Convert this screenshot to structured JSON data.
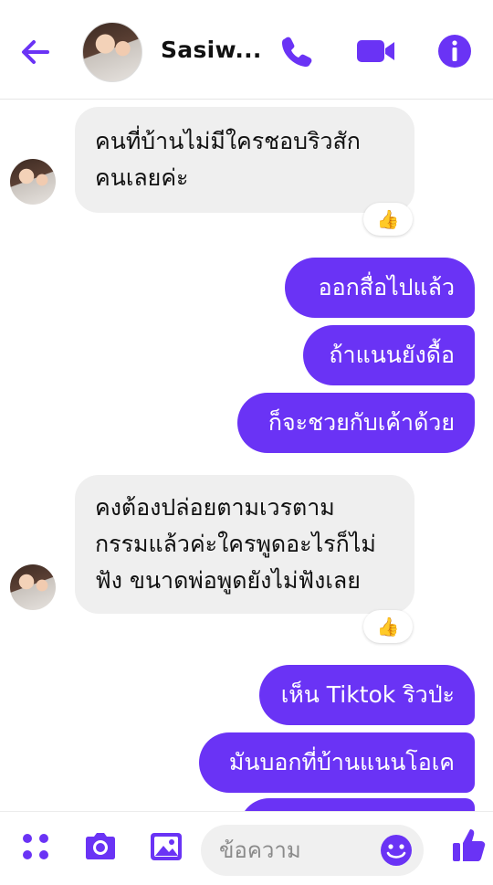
{
  "header": {
    "contact_name": "Sasiw...",
    "icons": [
      "back-arrow-icon",
      "phone-icon",
      "video-camera-icon",
      "info-icon"
    ]
  },
  "accent_color": "#6a33f5",
  "messages": [
    {
      "side": "in",
      "lines": [
        "คนที่บ้านไม่มีใครชอบริวสัก",
        "คนเลยค่ะ"
      ],
      "reaction": "👍"
    },
    {
      "side": "out",
      "text": "ออกสื่อไปแล้ว"
    },
    {
      "side": "out",
      "text": "ถ้าแนนยังดื้อ"
    },
    {
      "side": "out",
      "text": "ก็จะชวยกับเค้าด้วย"
    },
    {
      "side": "in",
      "lines": [
        "คงต้องปล่อยตามเวรตาม",
        "กรรมแล้วค่ะใครพูดอะไรก็ไม่",
        "ฟัง ขนาดพ่อพูดยังไม่ฟังเลย"
      ],
      "reaction": "👍"
    },
    {
      "side": "out",
      "text": "เห็น Tiktok ริวป่ะ"
    },
    {
      "side": "out",
      "text": "มันบอกที่บ้านแนนโอเค"
    },
    {
      "side": "out",
      "text": ""
    }
  ],
  "composer": {
    "placeholder": "ข้อความ",
    "icons": [
      "apps-grid-icon",
      "camera-icon",
      "image-icon",
      "emoji-icon",
      "like-thumb-icon"
    ]
  }
}
